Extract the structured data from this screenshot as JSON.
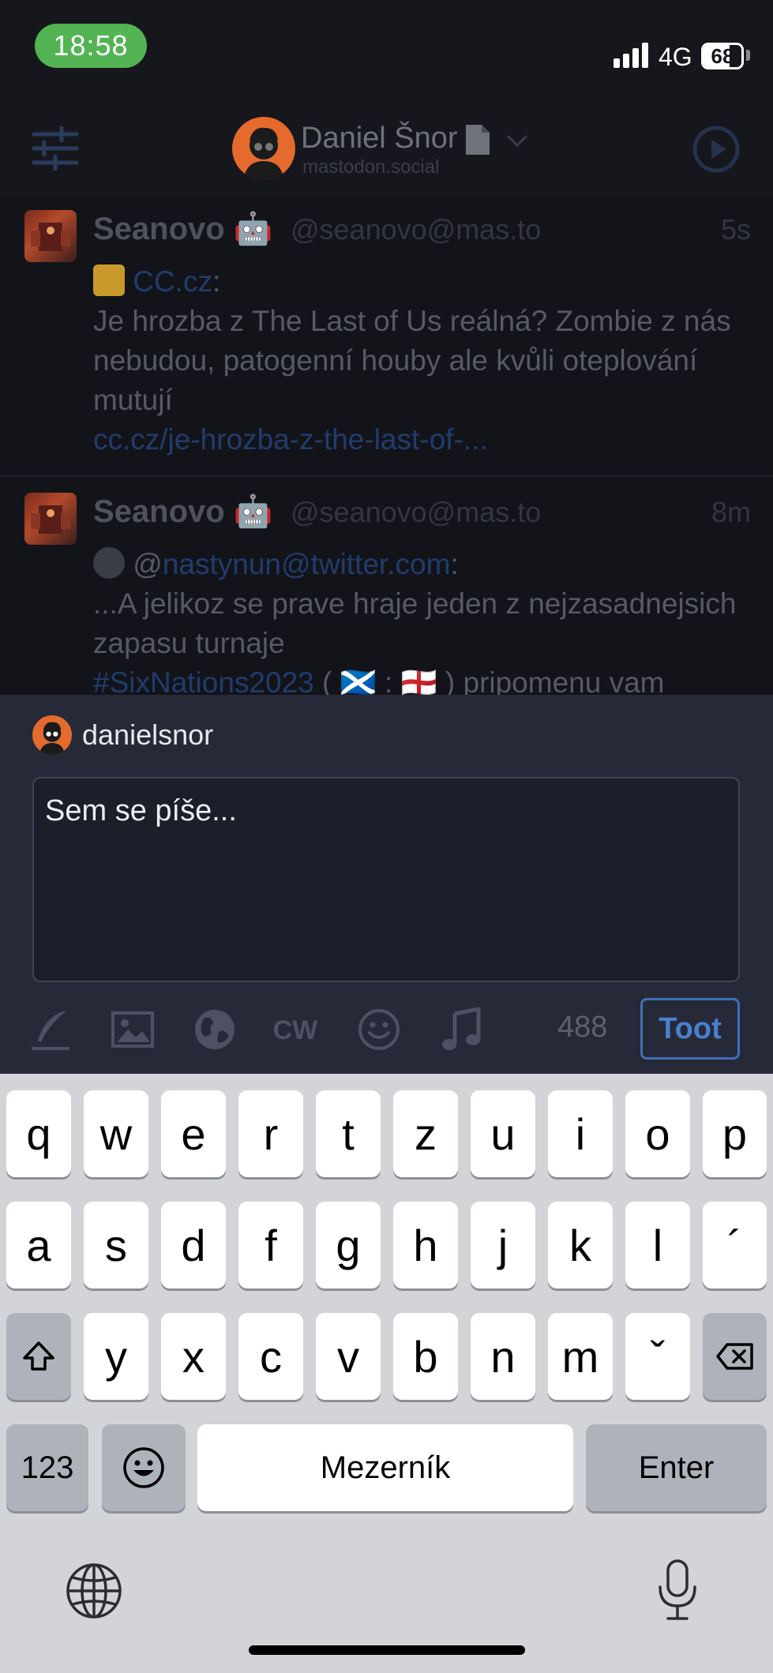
{
  "status_bar": {
    "time": "18:58",
    "network": "4G",
    "battery": "68",
    "battery_level": 0.68
  },
  "header": {
    "display_name": "Daniel Šnor",
    "server": "mastodon.social"
  },
  "posts": [
    {
      "name": "Seanovo",
      "handle": "@seanovo@mas.to",
      "time": "5s",
      "source_link": "CC.cz",
      "source_suffix": ":",
      "text": "Je hrozba z The Last of Us reálná? Zombie z nás nebudou, patogenní houby ale kvůli oteplování mutují",
      "link": "cc.cz/je-hrozba-z-the-last-of-..."
    },
    {
      "name": "Seanovo",
      "handle": "@seanovo@mas.to",
      "time": "8m",
      "mention_prefix": "@",
      "mention": "nastynun@twitter.com",
      "mention_suffix": ":",
      "text": "...A jelikoz se prave hraje jeden z nejzasadnejsich zapasu turnaje",
      "hashtag": "#SixNations2023",
      "text_after": " ( 🏴󠁧󠁢󠁳󠁣󠁴󠁿 : 🏴󠁧󠁢󠁥󠁮󠁧󠁿 ) pripomenu vam"
    }
  ],
  "composer": {
    "username": "danielsnor",
    "placeholder": "Sem se píše...",
    "counter": "488",
    "toot_label": "Toot",
    "cw_label": "CW"
  },
  "keyboard": {
    "row1": [
      "q",
      "w",
      "e",
      "r",
      "t",
      "z",
      "u",
      "i",
      "o",
      "p"
    ],
    "row2": [
      "a",
      "s",
      "d",
      "f",
      "g",
      "h",
      "j",
      "k",
      "l",
      "´"
    ],
    "row3": [
      "y",
      "x",
      "c",
      "v",
      "b",
      "n",
      "m",
      "ˇ"
    ],
    "numbers_label": "123",
    "space_label": "Mezerník",
    "enter_label": "Enter"
  },
  "colors": {
    "accent": "#3f6fb8",
    "time_pill": "#52b452",
    "composer_bg": "#262a38"
  }
}
